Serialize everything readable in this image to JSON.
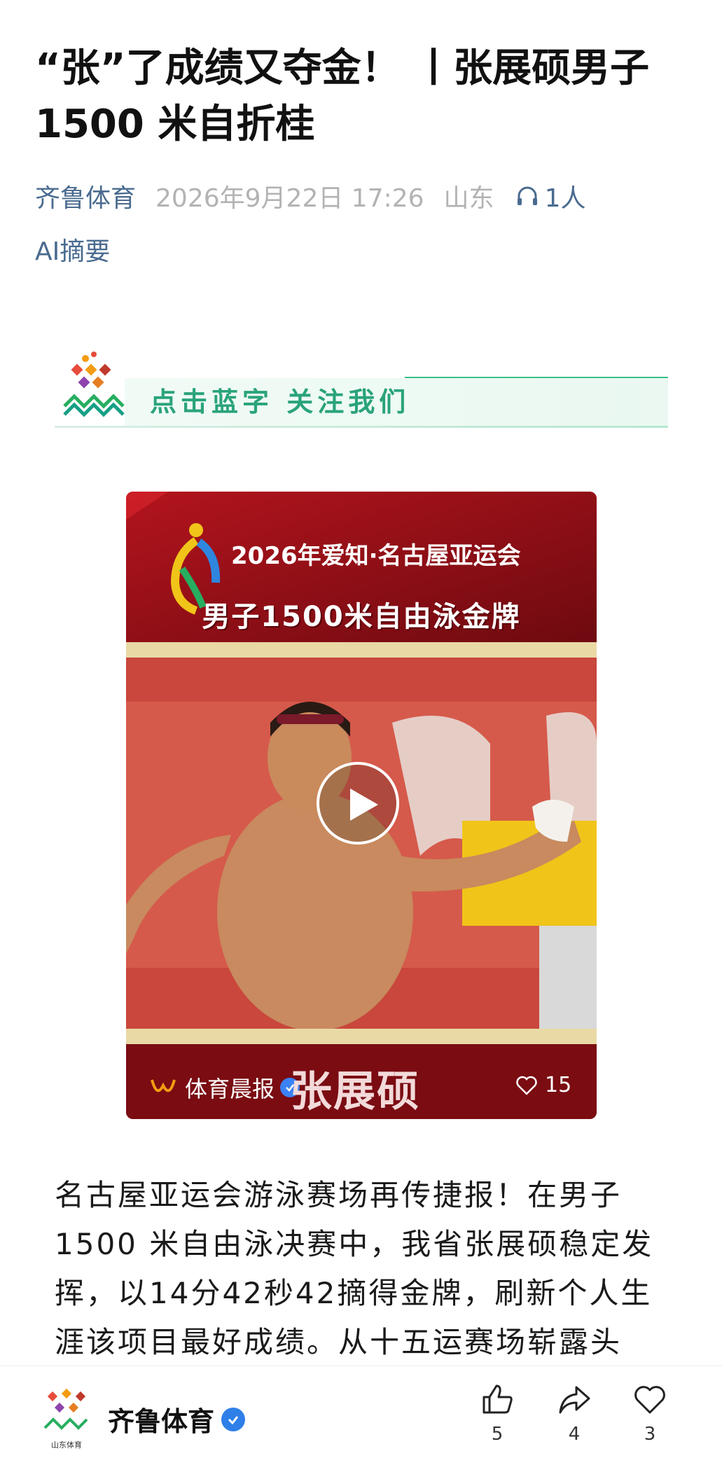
{
  "article": {
    "title": "“张”了成绩又夺金！ 丨张展硕男子1500 米自折桂",
    "source": "齐鲁体育",
    "date": "2026年9月22日 17:26",
    "region": "山东",
    "listeners": "1人",
    "ai_summary": "AI摘要"
  },
  "follow_banner": {
    "text": "点击蓝字 关注我们"
  },
  "video": {
    "header_top": "2026年爱知·名古屋亚运会",
    "header_title": "男子1500米自由泳金牌",
    "account": "体育晨报",
    "athlete_name": "张展硕",
    "likes": "15"
  },
  "body": {
    "paragraph": "名古屋亚运会游泳赛场再传捷报！在男子1500 米自由泳决赛中，我省张展硕稳定发挥，以14分42秒42摘得金牌，刷新个人生涯该项目最好成绩。从十五运赛场崭露头"
  },
  "bottom_bar": {
    "account_name": "齐鲁体育",
    "logo_caption": "山东体育",
    "like_count": "5",
    "share_count": "4",
    "favorite_count": "3"
  },
  "colors": {
    "link_blue": "#4a6b8f",
    "meta_gray": "#b3b3b3",
    "banner_green": "#2aa37b",
    "verified_blue": "#2f7fe8"
  }
}
